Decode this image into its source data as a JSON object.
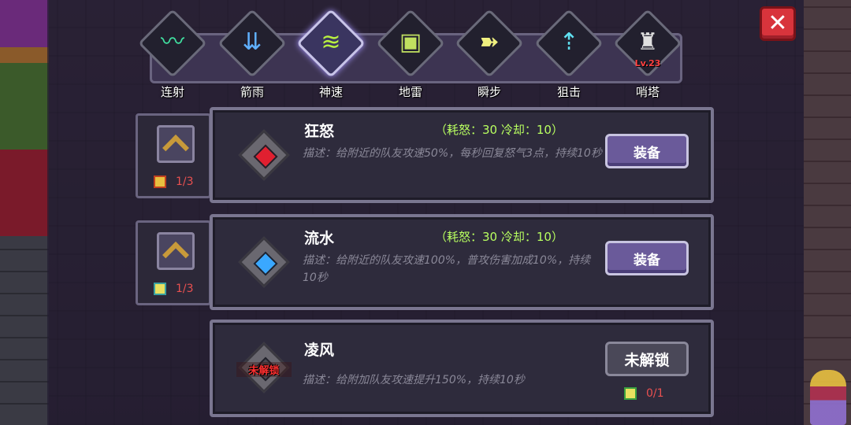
{
  "close": {
    "symbol": "✕",
    "color": "#d8343c"
  },
  "tabs": [
    {
      "label": "连射",
      "icon": "triple-shot-icon",
      "glyph": "〰",
      "color": "#40e0a0",
      "active": false
    },
    {
      "label": "箭雨",
      "icon": "arrow-rain-icon",
      "glyph": "⇊",
      "color": "#60b0ff",
      "active": false
    },
    {
      "label": "神速",
      "icon": "swift-speed-icon",
      "glyph": "≋",
      "color": "#b8f040",
      "active": true
    },
    {
      "label": "地雷",
      "icon": "landmine-icon",
      "glyph": "▣",
      "color": "#c0e060",
      "active": false
    },
    {
      "label": "瞬步",
      "icon": "blink-step-icon",
      "glyph": "➽",
      "color": "#f0f080",
      "active": false
    },
    {
      "label": "狙击",
      "icon": "snipe-icon",
      "glyph": "⇡",
      "color": "#60e0f0",
      "active": false
    },
    {
      "label": "哨塔",
      "icon": "sentry-tower-icon",
      "glyph": "♜",
      "color": "#e0e0e0",
      "active": false,
      "level": "Lv.23"
    }
  ],
  "skills": [
    {
      "name": "狂怒",
      "cost": "（耗怒：30  冷却：10）",
      "desc": "描述：给附近的队友攻速50%，每秒回复怒气3点，持续10秒",
      "gem_color": "#e02030",
      "button": "装备",
      "upgrade_count": "1/3",
      "book_color": "red"
    },
    {
      "name": "流水",
      "cost": "（耗怒：30  冷却：10）",
      "desc": "描述：给附近的队友攻速100%，普攻伤害加成10%，持续10秒",
      "gem_color": "#3aa8ff",
      "button": "装备",
      "upgrade_count": "1/3",
      "book_color": "teal"
    },
    {
      "name": "凌风",
      "desc": "描述：给附加队友攻速提升150%，持续10秒",
      "gem_text": "未解锁",
      "button": "未解锁",
      "unlock_count": "0/1"
    }
  ]
}
